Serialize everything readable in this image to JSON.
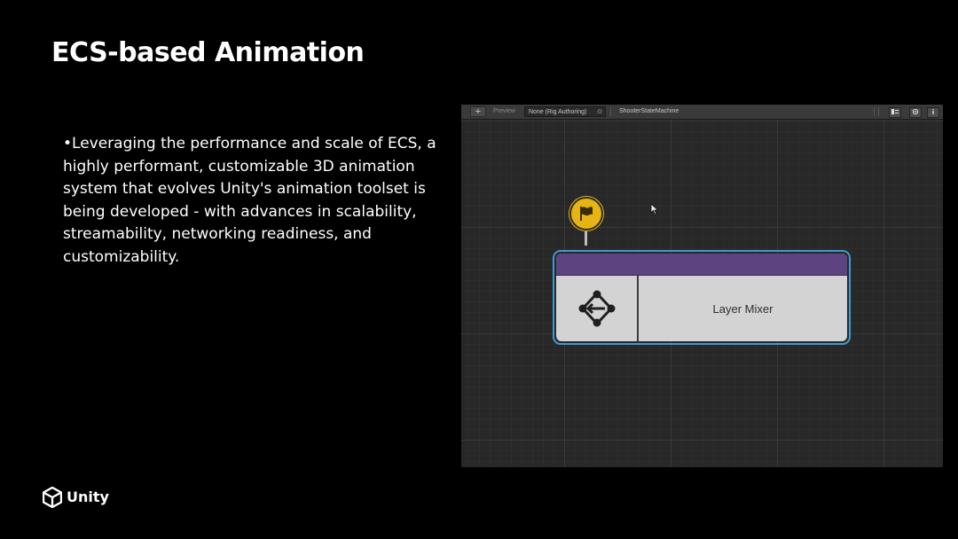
{
  "slide": {
    "title": "ECS-based Animation",
    "bullet": "•Leveraging the performance and scale of ECS, a highly performant, customizable 3D animation system that evolves Unity's animation toolset is being developed - with advances in scalability, streamability, networking readiness, and customizability."
  },
  "editor": {
    "toolbar": {
      "add_label": "+",
      "preview_label": "Preview",
      "rig_value": "None (Rig Authoring)",
      "rig_clear": "⊙",
      "state_machine": "ShooterStateMachine"
    },
    "nodes": {
      "entry_icon": "flag-icon",
      "mixer_label": "Layer Mixer",
      "mixer_icon": "layer-mixer-icon"
    },
    "colors": {
      "flag": "#e6b413",
      "mixer_header": "#5d4480",
      "selection": "#3e9ad6",
      "node_body": "#d3d3d3"
    }
  },
  "branding": {
    "logo_text": "Unity"
  }
}
